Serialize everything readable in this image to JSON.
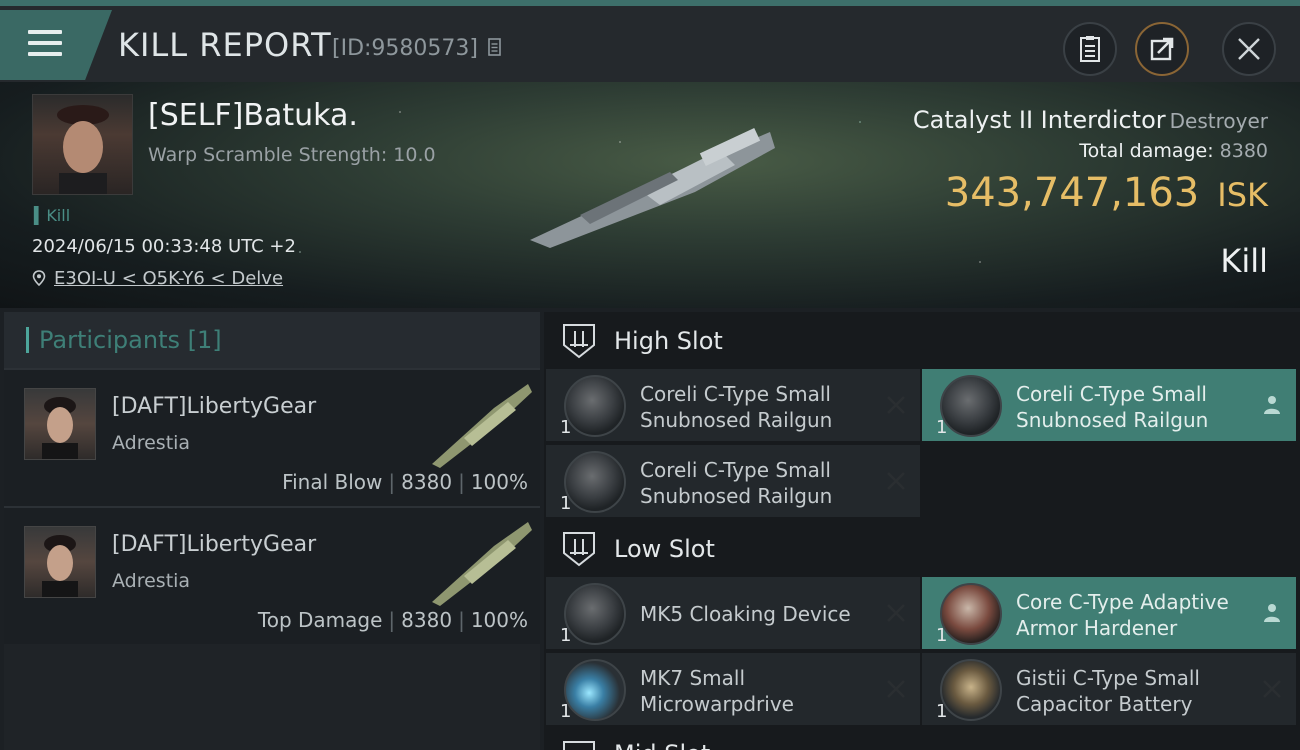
{
  "header": {
    "title": "KILL REPORT",
    "report_id": "[ID:9580573]",
    "colors": {
      "accent": "#3a6964",
      "gold": "#e6bd66"
    }
  },
  "victim": {
    "pilot": "[SELF]Batuka.",
    "warp_scramble": "Warp Scramble Strength: 10.0",
    "tag": "Kill",
    "datetime": "2024/06/15 00:33:48 UTC +2",
    "location": "E3OI-U < O5K-Y6 < Delve",
    "ship_name": "Catalyst II Interdictor",
    "ship_class": "Destroyer",
    "total_damage_label": "Total damage:",
    "total_damage": "8380",
    "isk_value": "343,747,163",
    "isk_unit": "ISK",
    "result": "Kill"
  },
  "participants": {
    "title": "Participants [1]",
    "rows": [
      {
        "name": "[DAFT]LibertyGear",
        "corp": "Adrestia",
        "role": "Final Blow",
        "damage": "8380",
        "percent": "100%"
      },
      {
        "name": "[DAFT]LibertyGear",
        "corp": "Adrestia",
        "role": "Top Damage",
        "damage": "8380",
        "percent": "100%"
      }
    ]
  },
  "fitting": {
    "high_slot_title": "High Slot",
    "low_slot_title": "Low Slot",
    "mid_slot_title": "Mid Slot",
    "high": [
      {
        "name": "Coreli C-Type Small Snubnosed Railgun",
        "qty": "1",
        "status": "destroyed",
        "icon": "railgun-icon"
      },
      {
        "name": "Coreli C-Type Small Snubnosed Railgun",
        "qty": "1",
        "status": "dropped",
        "icon": "railgun-icon"
      },
      {
        "name": "Coreli C-Type Small Snubnosed Railgun",
        "qty": "1",
        "status": "destroyed",
        "icon": "railgun-icon"
      }
    ],
    "low": [
      {
        "name": "MK5 Cloaking Device",
        "qty": "1",
        "status": "destroyed",
        "icon": "cloak-icon"
      },
      {
        "name": "Core C-Type Adaptive Armor Hardener",
        "qty": "1",
        "status": "dropped",
        "icon": "armor-hardener-icon"
      },
      {
        "name": "MK7 Small Microwarpdrive",
        "qty": "1",
        "status": "destroyed",
        "icon": "microwarpdrive-icon"
      },
      {
        "name": "Gistii C-Type Small Capacitor Battery",
        "qty": "1",
        "status": "destroyed",
        "icon": "capacitor-battery-icon"
      }
    ]
  }
}
